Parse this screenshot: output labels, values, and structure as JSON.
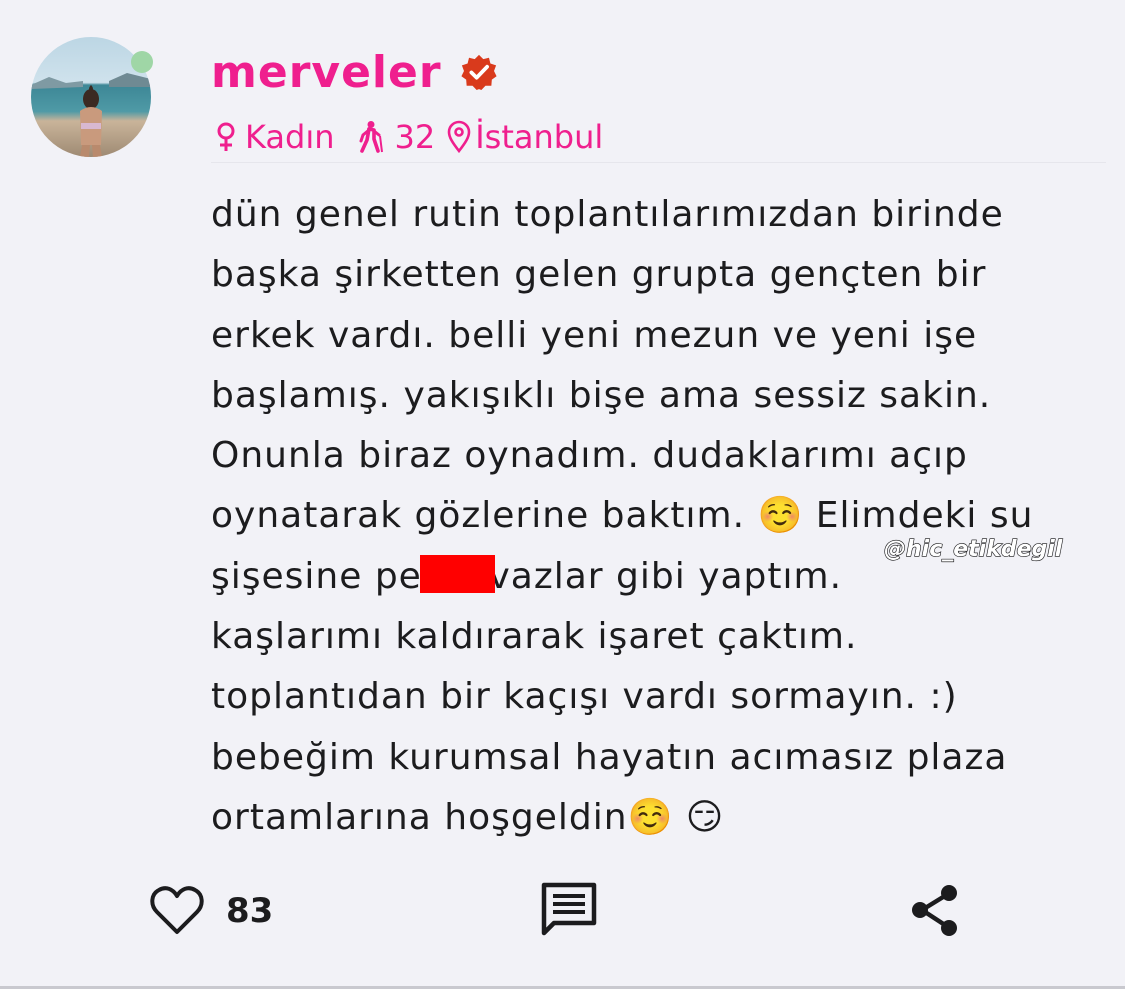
{
  "post": {
    "username": "merveler",
    "verified": true,
    "online": true,
    "profile": {
      "gender_icon": "female-symbol-icon",
      "gender": "Kadın",
      "age_icon": "walking-person-icon",
      "age": "32",
      "location_icon": "location-pin-icon",
      "location": "İstanbul"
    },
    "body": "dün genel rutin toplantılarımızdan birinde\nbaşka şirketten gelen grupta gençten bir\nerkek vardı. belli yeni mezun ve yeni işe\nbaşlamış. yakışıklı bişe ama sessiz sakin.\nOnunla biraz oynadım. dudaklarımı açıp\noynatarak gözlerine baktım. ☺️ Elimdeki su\nşişesine pe  i sıvazlar gibi yaptım.\nkaşlarımı kaldırarak işaret çaktım.\ntoplantıdan bir kaçışı vardı sormayın. :)\nbebeğim kurumsal hayatın acımasız plaza\nortamlarına hoşgeldin☺️ 😏",
    "watermark": "@hic_etikdegil"
  },
  "actions": {
    "like_icon": "heart-outline-icon",
    "like_count": "83",
    "comment_icon": "comment-icon",
    "share_icon": "share-icon"
  },
  "colors": {
    "accent": "#ef1f8e",
    "verified_badge": "#d93a1c",
    "online_dot": "#9fd6a6",
    "redaction": "#ff0000",
    "background": "#f2f2f7",
    "text": "#1c1c1e"
  }
}
